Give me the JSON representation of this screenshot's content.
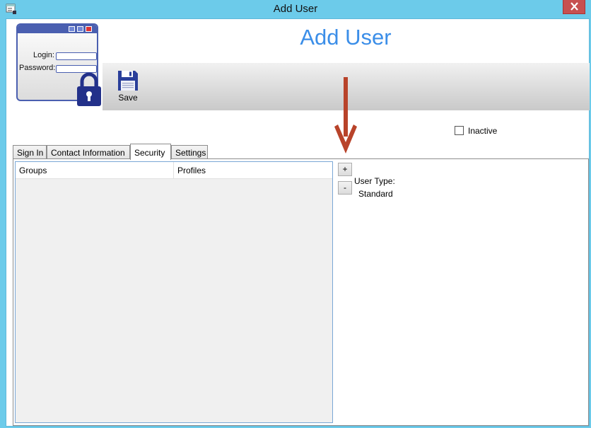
{
  "window": {
    "title": "Add User",
    "app_icon": "user-form-icon",
    "close_icon": "close-icon"
  },
  "header": {
    "title": "Add User",
    "title_color": "#3b8ee8",
    "logo": {
      "login_label": "Login:",
      "password_label": "Password:",
      "icon": "lock-icon"
    }
  },
  "toolbar": {
    "save_label": "Save",
    "save_icon": "floppy-disk-icon"
  },
  "annotation": {
    "icon": "down-arrow-icon",
    "color": "#b8432a"
  },
  "inactive": {
    "label": "Inactive",
    "checked": false
  },
  "tabs": [
    {
      "label": "Sign In",
      "active": false
    },
    {
      "label": "Contact Information",
      "active": false
    },
    {
      "label": "Security",
      "active": true
    },
    {
      "label": "Settings",
      "active": false
    }
  ],
  "security": {
    "columns": [
      "Groups",
      "Profiles"
    ],
    "rows": [],
    "add_label": "+",
    "remove_label": "-",
    "user_type_label": "User Type:",
    "user_type_value": "Standard"
  },
  "colors": {
    "frame": "#6ccbea",
    "toolbar_top": "#f1f1f1",
    "toolbar_bottom": "#c9c9c9"
  }
}
